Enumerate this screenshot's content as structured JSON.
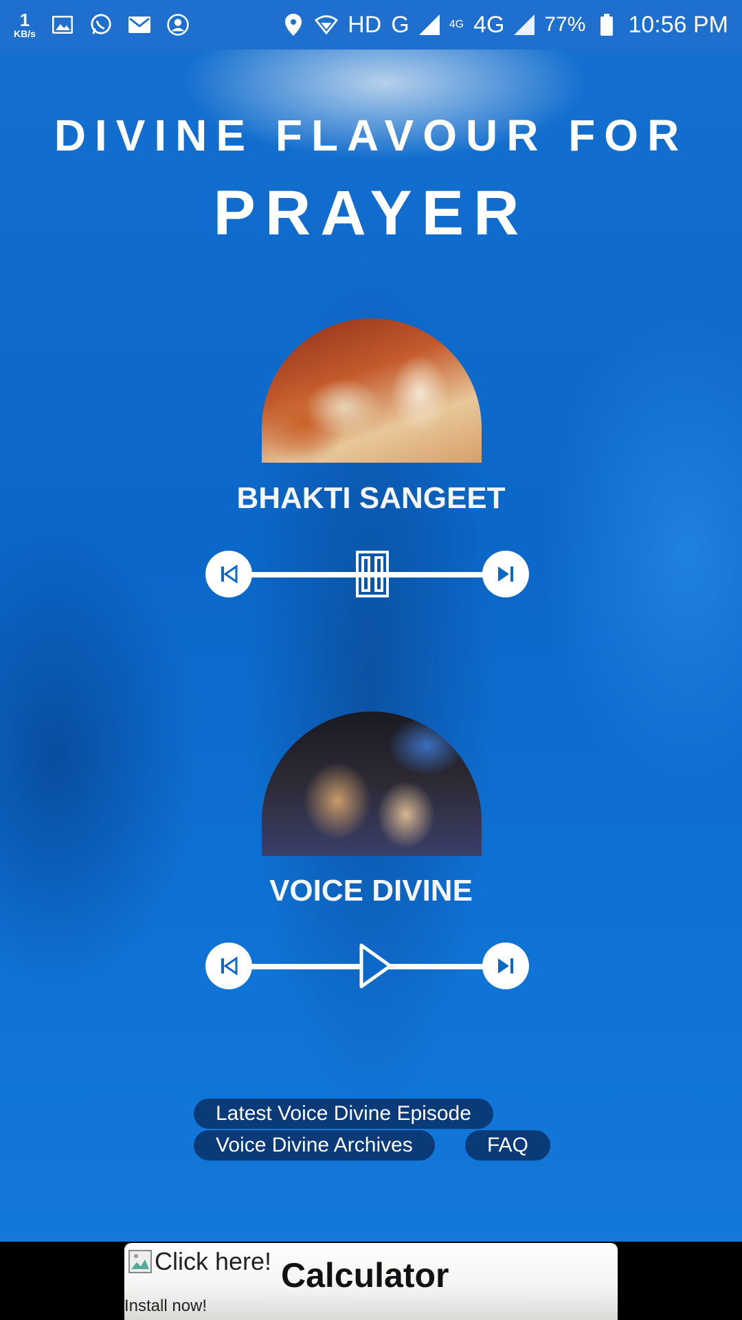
{
  "status_bar": {
    "speed_value": "1",
    "speed_unit": "KB/s",
    "network_hd": "HD",
    "network_g": "G",
    "network_4g_small": "4G",
    "network_4g": "4G",
    "battery": "77%",
    "time": "10:56 PM",
    "icons": [
      "gallery-icon",
      "whatsapp-icon",
      "gmail-icon",
      "vpn-icon",
      "location-icon",
      "wifi-icon",
      "signal-icon",
      "battery-icon"
    ]
  },
  "header": {
    "line1": "DIVINE FLAVOUR FOR",
    "line2": "PRAYER"
  },
  "channels": [
    {
      "name": "BHAKTI SANGEET",
      "state": "playing"
    },
    {
      "name": "VOICE DIVINE",
      "state": "paused"
    }
  ],
  "links": {
    "latest": "Latest Voice Divine Episode",
    "archives": "Voice Divine Archives",
    "faq": "FAQ"
  },
  "ad": {
    "image_alt": "Click here!",
    "title": "Calculator",
    "subtitle": "Install now!"
  },
  "colors": {
    "status_bar": "#1f6fcf",
    "background": "#0b67c8",
    "pill": "#0b3a78",
    "white": "#ffffff"
  }
}
